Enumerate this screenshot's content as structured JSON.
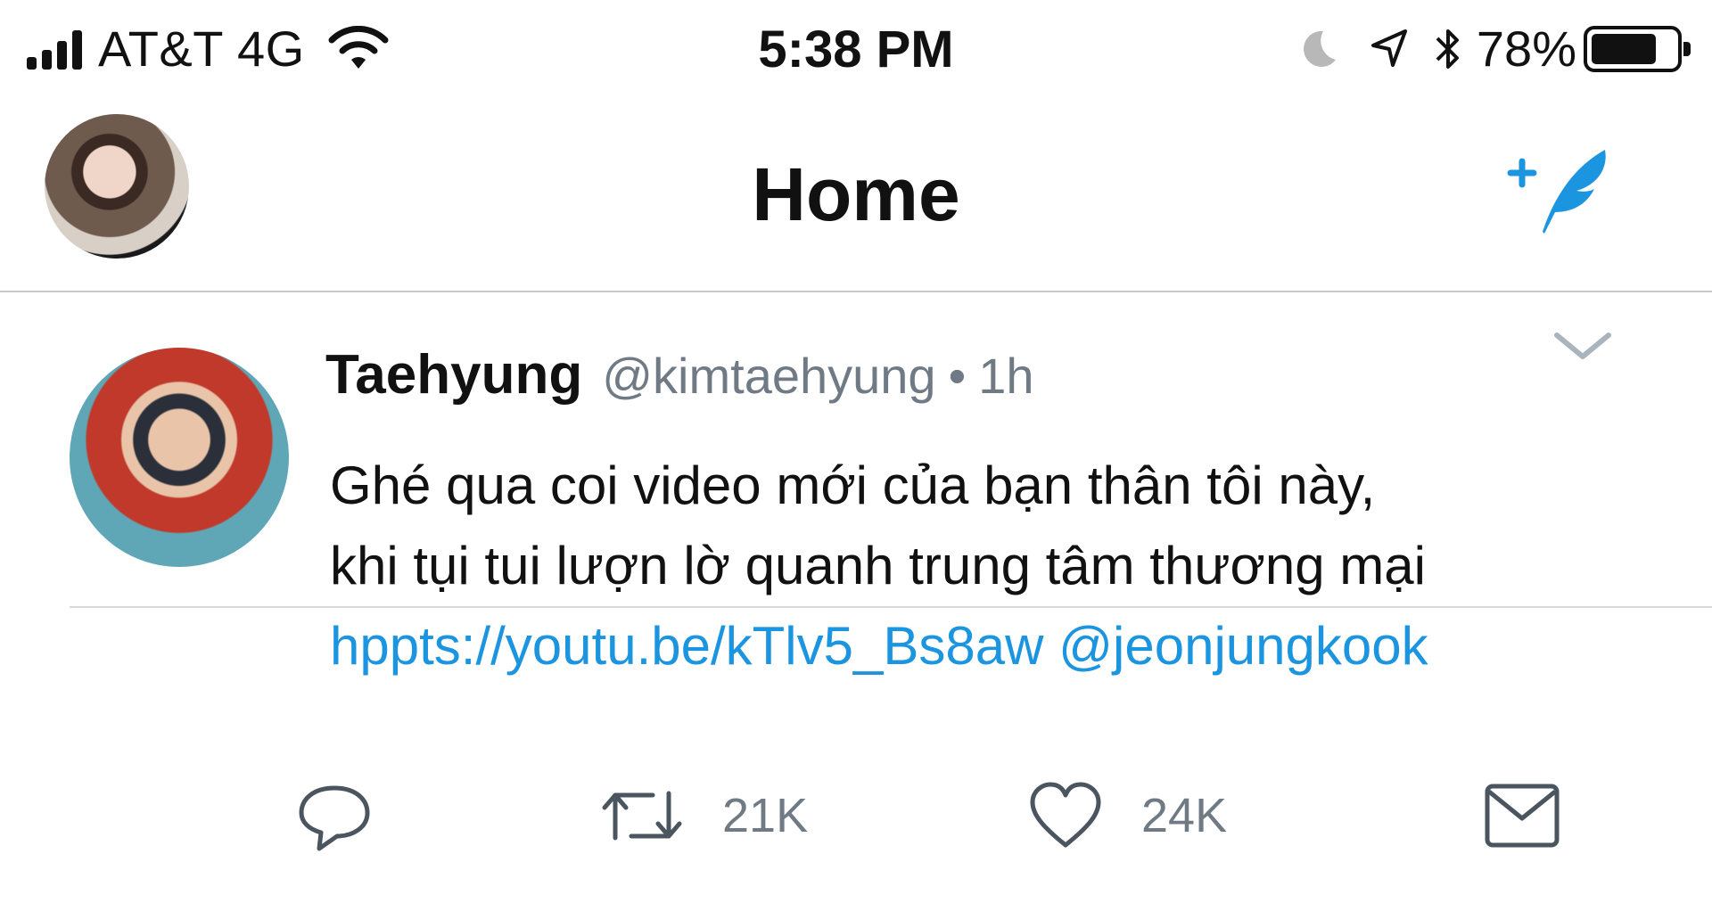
{
  "status_bar": {
    "carrier": "AT&T 4G",
    "time": "5:38 PM",
    "battery_percent_text": "78%",
    "battery_level": 0.78,
    "icons": [
      "signal-icon",
      "wifi-icon",
      "moon-icon",
      "location-arrow-icon",
      "bluetooth-icon",
      "battery-icon"
    ]
  },
  "nav": {
    "title": "Home",
    "compose_icon": "compose-tweet-icon",
    "accent_color": "#1b95e0"
  },
  "tweet": {
    "display_name": "Taehyung",
    "handle": "@kimtaehyung",
    "separator": "•",
    "time_ago": "1h",
    "text_line1": "Ghé qua coi video mới của bạn thân tôi này,",
    "text_line2": "khi tụi tui lượn lờ quanh trung tâm thương mại",
    "link": "hppts://youtu.be/kTlv5_Bs8aw",
    "mention": "@jeonjungkook",
    "retweet_count": "21K",
    "like_count": "24K"
  }
}
